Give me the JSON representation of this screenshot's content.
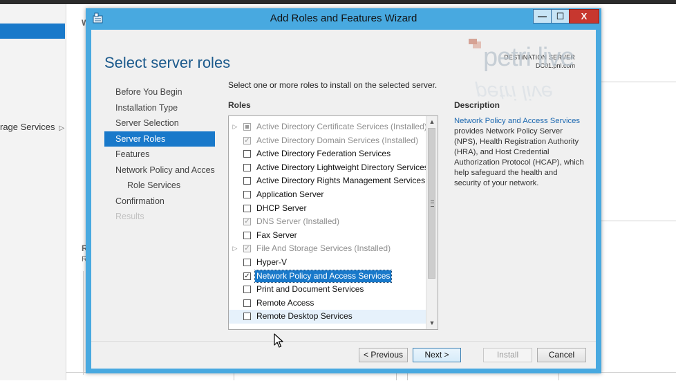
{
  "background": {
    "storage_label": "rage Services",
    "letter_w": "W",
    "letter_r1": "R",
    "letter_r2": "R"
  },
  "window": {
    "title": "Add Roles and Features Wizard",
    "min_glyph": "—",
    "max_glyph": "☐",
    "close_glyph": "X"
  },
  "header": {
    "page_title": "Select server roles",
    "dest_label": "DESTINATION SERVER",
    "dest_server": "DC01.pnl.com"
  },
  "watermark": {
    "text": "petri live"
  },
  "nav": {
    "items": [
      {
        "label": "Before You Begin"
      },
      {
        "label": "Installation Type"
      },
      {
        "label": "Server Selection"
      },
      {
        "label": "Server Roles"
      },
      {
        "label": "Features"
      },
      {
        "label": "Network Policy and Acces..."
      },
      {
        "label": "Role Services"
      },
      {
        "label": "Confirmation"
      },
      {
        "label": "Results"
      }
    ]
  },
  "main": {
    "instruction": "Select one or more roles to install on the selected server.",
    "roles_header": "Roles",
    "roles": [
      {
        "label": "Active Directory Certificate Services (Installed)"
      },
      {
        "label": "Active Directory Domain Services (Installed)"
      },
      {
        "label": "Active Directory Federation Services"
      },
      {
        "label": "Active Directory Lightweight Directory Services"
      },
      {
        "label": "Active Directory Rights Management Services"
      },
      {
        "label": "Application Server"
      },
      {
        "label": "DHCP Server"
      },
      {
        "label": "DNS Server (Installed)"
      },
      {
        "label": "Fax Server"
      },
      {
        "label": "File And Storage Services (Installed)"
      },
      {
        "label": "Hyper-V"
      },
      {
        "label": "Network Policy and Access Services"
      },
      {
        "label": "Print and Document Services"
      },
      {
        "label": "Remote Access"
      },
      {
        "label": "Remote Desktop Services"
      }
    ],
    "description_header": "Description",
    "description_link": "Network Policy and Access Services",
    "description_body": "provides Network Policy Server (NPS), Health Registration Authority (HRA), and Host Credential Authorization Protocol (HCAP), which help safeguard the health and security of your network."
  },
  "footer": {
    "previous": "< Previous",
    "next": "Next >",
    "install": "Install",
    "cancel": "Cancel"
  },
  "colors": {
    "accent": "#1979ca",
    "window_frame": "#48a9e0",
    "title_blue": "#1c5a8c"
  }
}
